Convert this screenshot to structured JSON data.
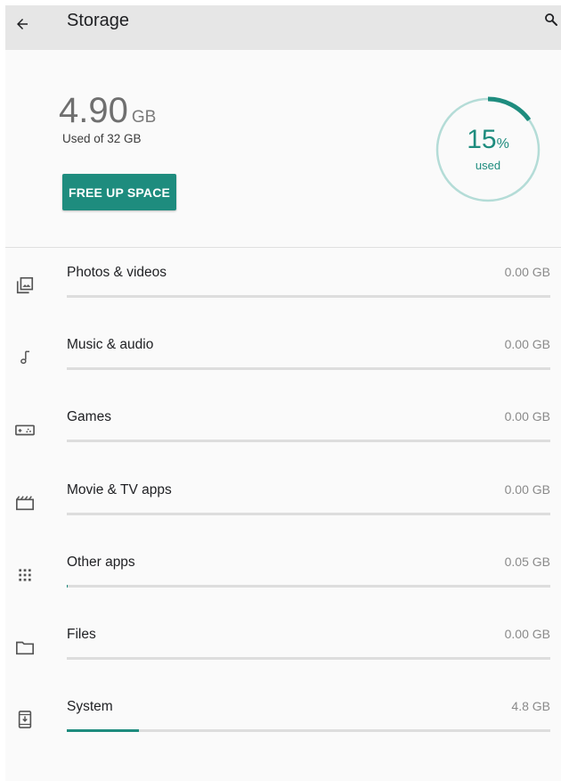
{
  "appbar": {
    "title": "Storage",
    "back_icon": "arrow-back-icon",
    "search_icon": "search-icon"
  },
  "summary": {
    "used_value": "4.90",
    "used_unit": "GB",
    "used_of_label": "Used of 32 GB",
    "free_up_button": "FREE UP SPACE",
    "donut_percent": "15",
    "donut_percent_sign": "%",
    "donut_label": "used",
    "donut_fraction": 0.15
  },
  "colors": {
    "accent": "#1e8c7e",
    "ring_track": "#b4dcd7",
    "appbar_bg": "#e6e6e6",
    "bar_track": "#dddddd"
  },
  "categories": [
    {
      "label": "Photos & videos",
      "size": "0.00 GB",
      "icon": "photo-library-icon",
      "fraction": 0
    },
    {
      "label": "Music & audio",
      "size": "0.00 GB",
      "icon": "music-note-icon",
      "fraction": 0
    },
    {
      "label": "Games",
      "size": "0.00 GB",
      "icon": "gamepad-icon",
      "fraction": 0
    },
    {
      "label": "Movie & TV apps",
      "size": "0.00 GB",
      "icon": "movie-icon",
      "fraction": 0
    },
    {
      "label": "Other apps",
      "size": "0.05 GB",
      "icon": "apps-grid-icon",
      "fraction": 0.001
    },
    {
      "label": "Files",
      "size": "0.00 GB",
      "icon": "folder-icon",
      "fraction": 0
    },
    {
      "label": "System",
      "size": "4.8 GB",
      "icon": "system-update-icon",
      "fraction": 0.15
    }
  ]
}
